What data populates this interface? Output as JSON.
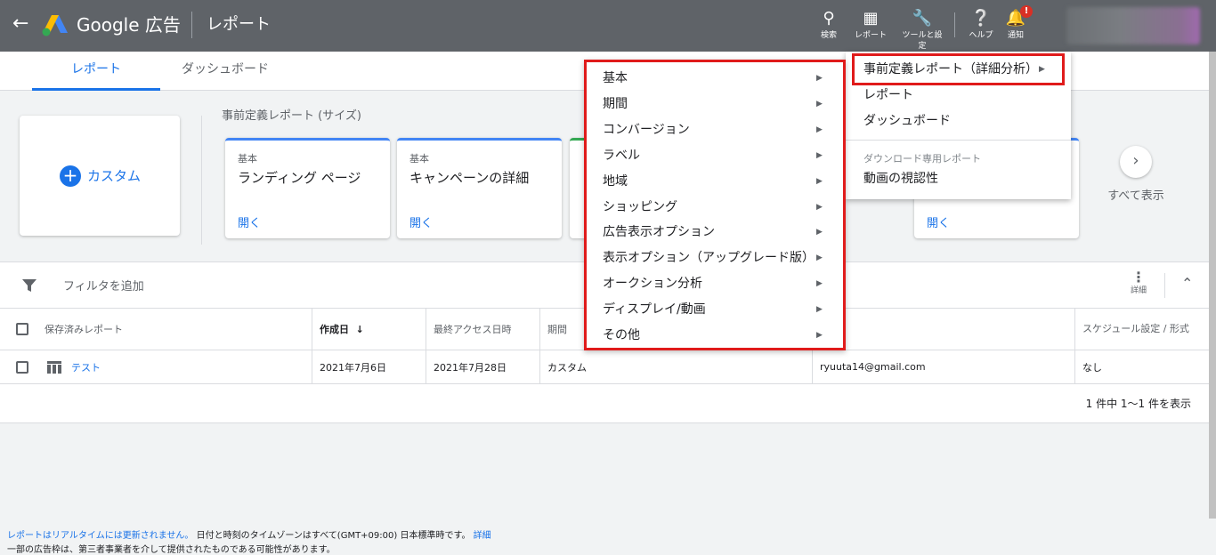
{
  "header": {
    "brand": "Google 広告",
    "page_title": "レポート",
    "tools": [
      {
        "label": "検索",
        "icon": "search-icon"
      },
      {
        "label": "レポート",
        "icon": "bar-chart-icon"
      },
      {
        "label": "ツールと設定",
        "icon": "wrench-icon"
      },
      {
        "label": "ヘルプ",
        "icon": "help-icon"
      },
      {
        "label": "通知",
        "icon": "bell-icon"
      }
    ],
    "notification_badge": "!"
  },
  "tabs": [
    {
      "label": "レポート",
      "active": true
    },
    {
      "label": "ダッシュボード",
      "active": false
    }
  ],
  "predefined": {
    "custom_label": "カスタム",
    "section_title": "事前定義レポート (サイズ)",
    "cards": [
      {
        "category": "基本",
        "name": "ランディング ページ",
        "action": "開く"
      },
      {
        "category": "基本",
        "name": "キャンペーンの詳細",
        "action": "開く"
      },
      {
        "category": "",
        "name": "",
        "action": "開く"
      }
    ],
    "view_all": "すべて表示"
  },
  "filter": {
    "label": "フィルタを追加",
    "more_label": "詳細"
  },
  "table": {
    "headers": [
      "保存済みレポート",
      "作成日",
      "最終アクセス日時",
      "期間",
      "",
      "スケジュール設定 / 形式"
    ],
    "sort_indicator": "↓",
    "rows": [
      {
        "name": "テスト",
        "created": "2021年7月6日",
        "last_access": "2021年7月28日",
        "period": "カスタム",
        "owner": "ryuuta14@gmail.com",
        "schedule": "なし"
      }
    ],
    "pagination": "1 件中 1～1 件を表示"
  },
  "dropdown": {
    "items": [
      "事前定義レポート（詳細分析）",
      "レポート",
      "ダッシュボード"
    ],
    "download_header": "ダウンロード専用レポート",
    "download_items": [
      "動画の視認性"
    ]
  },
  "submenu": {
    "items": [
      "基本",
      "期間",
      "コンバージョン",
      "ラベル",
      "地域",
      "ショッピング",
      "広告表示オプション",
      "表示オプション（アップグレード版）",
      "オークション分析",
      "ディスプレイ/動画",
      "その他"
    ]
  },
  "footer": {
    "line1_link": "レポートはリアルタイムには更新されません。",
    "line1_text": "日付と時刻のタイムゾーンはすべて(GMT+09:00) 日本標準時です。",
    "line1_more": "詳細",
    "line2": "一部の広告枠は、第三者事業者を介して提供されたものである可能性があります。"
  },
  "colors": {
    "header_bg": "#5f6368",
    "accent": "#1a73e8",
    "highlight": "#e01b1b"
  }
}
